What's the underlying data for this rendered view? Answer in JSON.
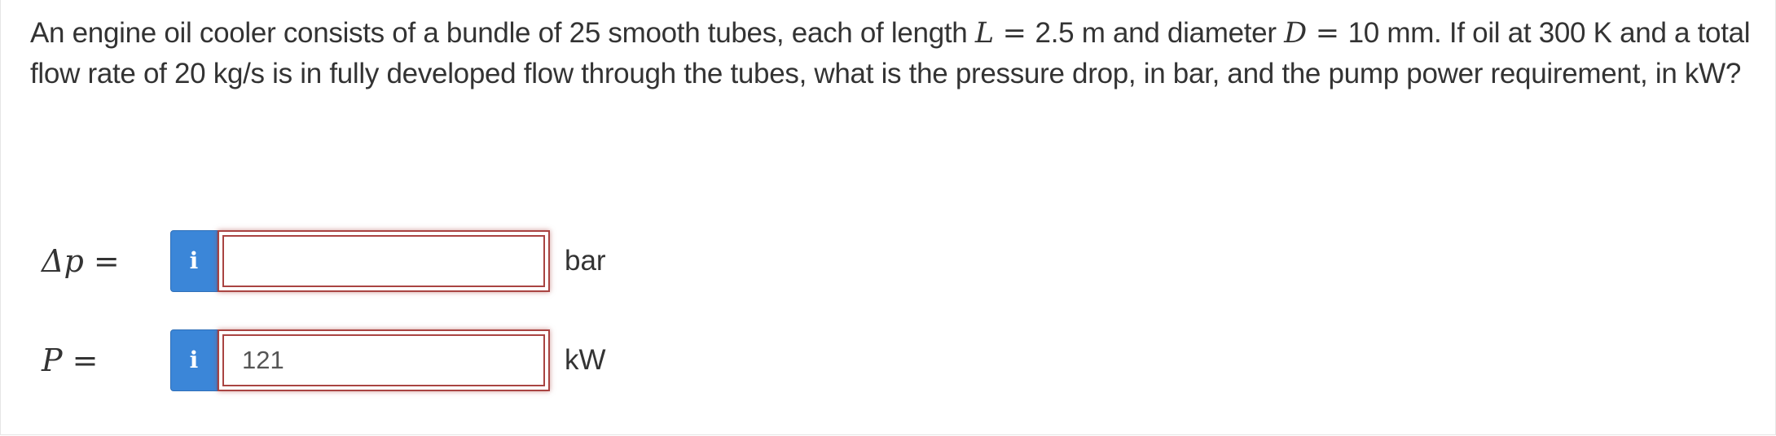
{
  "question": {
    "part1": "An engine oil cooler consists of a bundle of 25 smooth tubes, each of length ",
    "var_L": "L",
    "eq1": " = ",
    "part2": "2.5 m and diameter ",
    "var_D": "D",
    "eq2": " = ",
    "part3": "10 mm. If oil at 300 K and a total flow rate of 20 kg/s is in fully developed flow through the tubes, what is the pressure drop, in bar, and the pump power requirement, in kW?"
  },
  "answers": [
    {
      "label_symbol": "Δp",
      "label_equals": " =",
      "info_icon": "info-icon",
      "value": "",
      "placeholder": "",
      "unit": "bar"
    },
    {
      "label_symbol": "P",
      "label_equals": " =",
      "info_icon": "info-icon",
      "value": "121",
      "placeholder": "",
      "unit": "kW"
    }
  ],
  "colors": {
    "info_button": "#3b86d8",
    "error_border": "#a94442",
    "text": "#333333"
  }
}
